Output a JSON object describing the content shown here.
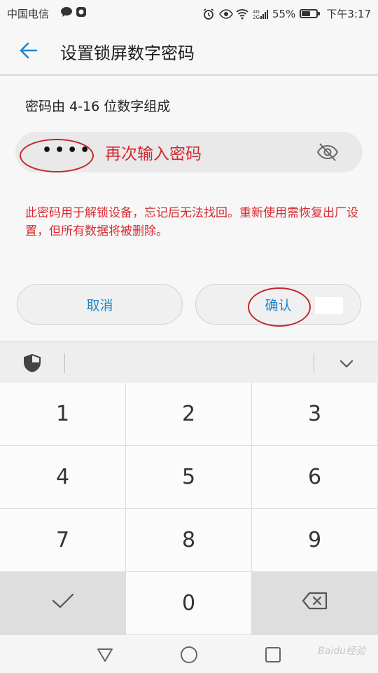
{
  "status_bar": {
    "carrier": "中国电信",
    "battery": "55%",
    "battery_level": 0.55,
    "time": "下午3:17",
    "network": "4G"
  },
  "header": {
    "title": "设置锁屏数字密码",
    "back_icon": "arrow-left-icon"
  },
  "hint": "密码由 4-16 位数字组成",
  "password": {
    "value": "••••",
    "annotation": "再次输入密码",
    "visibility_icon": "eye-off-icon"
  },
  "warning": "此密码用于解锁设备，忘记后无法找回。重新使用需恢复出厂设置，但所有数据将被删除。",
  "buttons": {
    "cancel": "取消",
    "confirm": "确认"
  },
  "keyboard": {
    "keys": [
      "1",
      "2",
      "3",
      "4",
      "5",
      "6",
      "7",
      "8",
      "9",
      "✓",
      "0",
      "⌫"
    ]
  },
  "watermark": "Baidu经验",
  "colors": {
    "accent": "#1d86c9",
    "warning": "#d8282e",
    "annotation": "#c0282d"
  }
}
